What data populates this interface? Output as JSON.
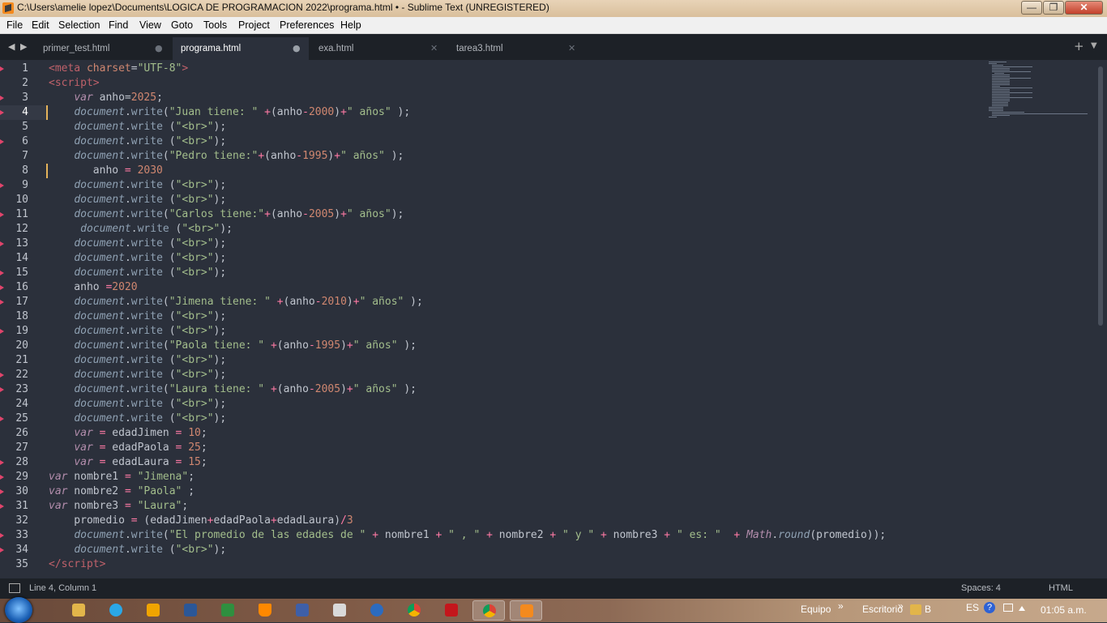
{
  "window": {
    "title": "C:\\Users\\amelie lopez\\Documents\\LOGICA DE PROGRAMACION 2022\\programa.html • - Sublime Text (UNREGISTERED)",
    "min_glyph": "—",
    "max_glyph": "❐",
    "close_glyph": "✕"
  },
  "menu": [
    "File",
    "Edit",
    "Selection",
    "Find",
    "View",
    "Goto",
    "Tools",
    "Project",
    "Preferences",
    "Help"
  ],
  "tabs": [
    {
      "label": "primer_test.html",
      "control": "●"
    },
    {
      "label": "programa.html",
      "control": "●",
      "active": true
    },
    {
      "label": "exa.html",
      "control": "✕"
    },
    {
      "label": "tarea3.html",
      "control": "✕"
    }
  ],
  "tabbar": {
    "nav_prev": "◀",
    "nav_next": "▶",
    "new_tab": "+",
    "tab_menu": "▼"
  },
  "editor": {
    "current_line": 4,
    "line_numbers": [
      "1",
      "2",
      "3",
      "4",
      "5",
      "6",
      "7",
      "8",
      "9",
      "10",
      "11",
      "12",
      "13",
      "14",
      "15",
      "16",
      "17",
      "18",
      "19",
      "20",
      "21",
      "22",
      "23",
      "24",
      "25",
      "26",
      "27",
      "28",
      "29",
      "30",
      "31",
      "32",
      "33",
      "34",
      "35"
    ],
    "modified_lines": [
      4,
      8
    ],
    "marked_lines": [
      1,
      3,
      4,
      6,
      9,
      11,
      13,
      15,
      16,
      17,
      19,
      22,
      23,
      25,
      28,
      29,
      30,
      31,
      33,
      34
    ]
  },
  "status": {
    "position": "Line 4, Column 1",
    "indent": "Spaces: 4",
    "syntax": "HTML"
  },
  "taskbar": {
    "items": [
      "explorer",
      "skype",
      "media-player",
      "word",
      "excel",
      "vlc",
      "disk-utility",
      "calculator",
      "mu",
      "chrome",
      "acrobat",
      "chrome-active",
      "sublime-active"
    ],
    "equipo": "Equipo",
    "escritorio": "Escritorio",
    "b_label": "B",
    "lang": "ES",
    "clock": "01:05 a.m.",
    "chevron": "»"
  }
}
